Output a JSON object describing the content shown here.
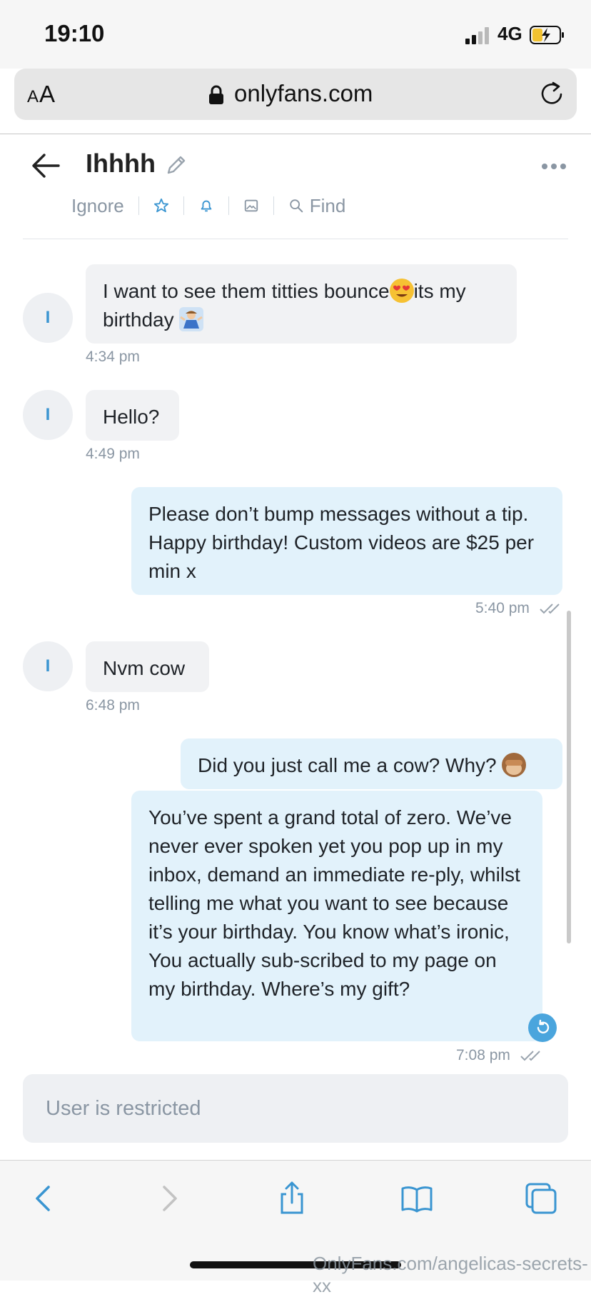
{
  "status": {
    "time": "19:10",
    "network": "4G",
    "icons": [
      "signal-icon",
      "battery-charging-icon"
    ]
  },
  "browser": {
    "text_size_label_small": "A",
    "text_size_label_large": "A",
    "domain": "onlyfans.com",
    "icons": [
      "lock-icon",
      "reload-icon"
    ]
  },
  "chat": {
    "title": "Ihhhh",
    "toolbar": {
      "ignore": "Ignore",
      "find": "Find"
    },
    "icons": [
      "back-arrow-icon",
      "edit-pencil-icon",
      "more-icon",
      "star-icon",
      "bell-icon",
      "image-icon",
      "search-icon"
    ]
  },
  "messages": [
    {
      "direction": "in",
      "avatar": "I",
      "text": "I want to see them titties bounce",
      "emoji1": "heart-eyes-emoji",
      "text2": "its my",
      "text3": "birthday",
      "emoji2": "shrug-emoji",
      "time": "4:34 pm"
    },
    {
      "direction": "in",
      "avatar": "I",
      "text": "Hello?",
      "time": "4:49 pm"
    },
    {
      "direction": "out",
      "text": "Please don’t bump messages without a tip. Happy birthday! Custom videos are $25 per min x",
      "time": "5:40 pm"
    },
    {
      "direction": "in",
      "avatar": "I",
      "text": "Nvm cow",
      "time": "6:48 pm"
    },
    {
      "direction": "out",
      "text": "Did you just call me a cow? Why?",
      "emoji": "see-no-evil-monkey-emoji"
    },
    {
      "direction": "out",
      "text": "You’ve spent a grand total of zero. We’ve never ever spoken yet you pop up in my inbox, demand an immediate re-ply, whilst telling me what you want to see because it’s your birthday. You know what’s ironic, You actually sub-scribed to my page on my birthday. Where’s my gift?",
      "time": "7:08 pm"
    }
  ],
  "input": {
    "restricted_text": "User is restricted"
  },
  "bottom_nav": {
    "icons": [
      "back-chevron-icon",
      "forward-chevron-icon",
      "share-icon",
      "bookmarks-icon",
      "tabs-icon"
    ]
  },
  "watermark": "OnlyFans.com/angelicas-secrets-xx",
  "colors": {
    "accent": "#3a95d1",
    "incoming_bubble": "#f1f2f4",
    "outgoing_bubble": "#e2f2fb",
    "muted_text": "#8a96a3"
  }
}
